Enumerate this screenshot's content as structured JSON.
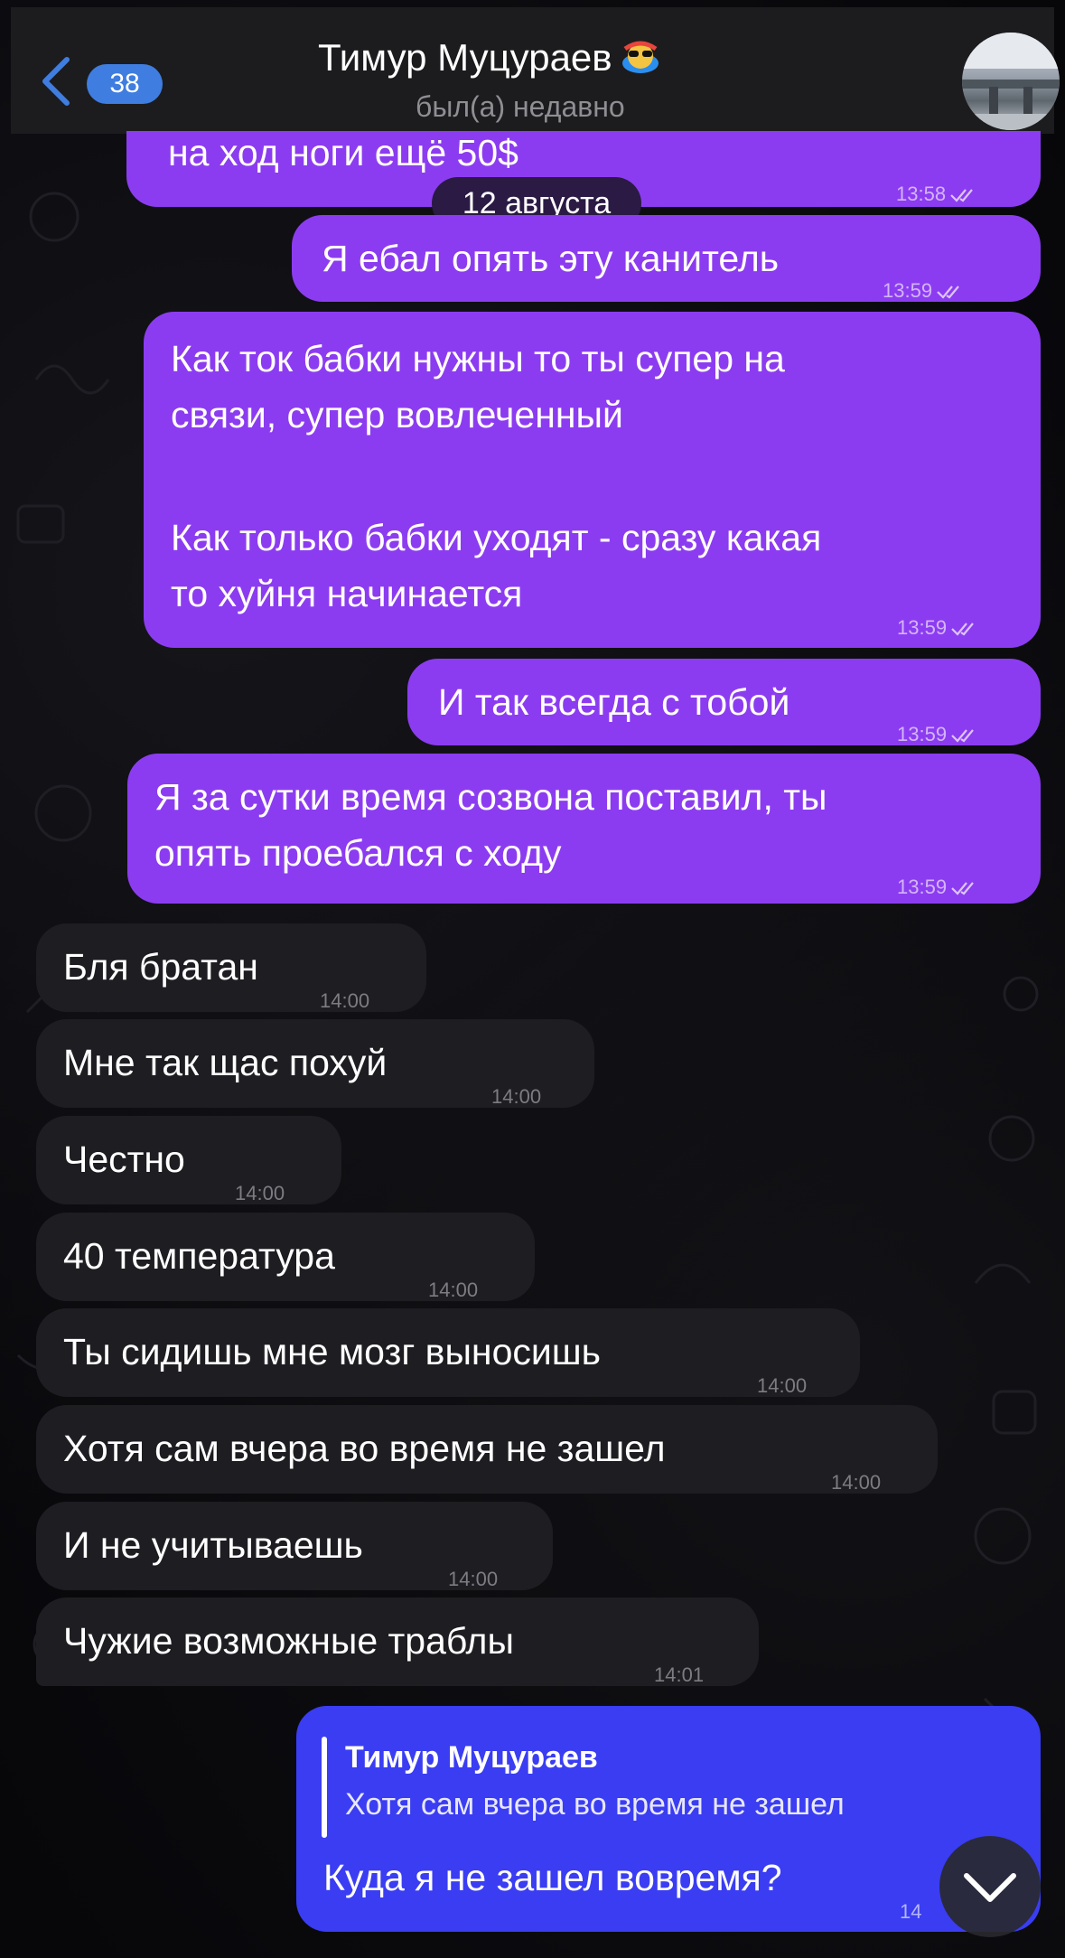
{
  "header": {
    "back_count": "38",
    "title": "Тимур Муцураев",
    "status": "был(а) недавно"
  },
  "date_label": "12 августа",
  "messages": [
    {
      "text": "на ход ноги ещё 50$",
      "time": "13:58",
      "dir": "out"
    },
    {
      "text": "Я ебал опять эту канитель",
      "time": "13:59",
      "dir": "out"
    },
    {
      "lines": [
        "Как ток бабки нужны то ты супер на",
        "связи, супер вовлеченный",
        "",
        "Как только бабки уходят - сразу какая",
        "то хуйня начинается"
      ],
      "time": "13:59",
      "dir": "out"
    },
    {
      "text": "И так всегда с тобой",
      "time": "13:59",
      "dir": "out"
    },
    {
      "lines": [
        "Я за сутки время созвона поставил, ты",
        "опять проебался с ходу"
      ],
      "time": "13:59",
      "dir": "out"
    },
    {
      "text": "Бля братан",
      "time": "14:00",
      "dir": "in"
    },
    {
      "text": "Мне так щас похуй",
      "time": "14:00",
      "dir": "in"
    },
    {
      "text": "Честно",
      "time": "14:00",
      "dir": "in"
    },
    {
      "text": "40 температура",
      "time": "14:00",
      "dir": "in"
    },
    {
      "text": "Ты сидишь мне мозг выносишь",
      "time": "14:00",
      "dir": "in"
    },
    {
      "text": "Хотя сам вчера во время не зашел",
      "time": "14:00",
      "dir": "in"
    },
    {
      "text": "И не учитываешь",
      "time": "14:00",
      "dir": "in"
    },
    {
      "text": "Чужие возможные траблы",
      "time": "14:01",
      "dir": "in"
    }
  ],
  "reply": {
    "quote_name": "Тимур Муцураев",
    "quote_text": "Хотя сам вчера во время не зашел",
    "text": "Куда я не зашел вовремя?",
    "time": "14"
  },
  "colors": {
    "outgoing": "#8c3cf0",
    "incoming": "#1d1d22",
    "reply_outgoing": "#3a3df2",
    "badge": "#3f7de0",
    "accent_back": "#3f7de0"
  },
  "icons": [
    "back-chevron-icon",
    "sunglasses-emoji-icon",
    "double-check-icon",
    "chevron-down-icon"
  ]
}
